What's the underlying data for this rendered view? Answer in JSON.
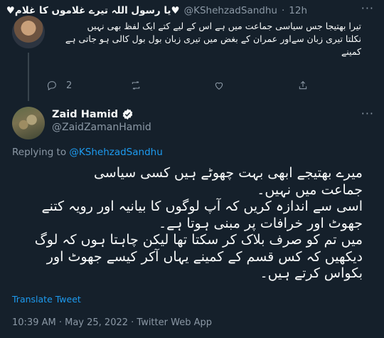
{
  "reply": {
    "display_name": "♥یا رسول اللہ تیرے غلاموں کا غلام♥",
    "handle": "@KShehzadSandhu",
    "separator": "·",
    "time": "12h",
    "text_lines": [
      "تیرا بھتیجا جس سیاسی جماعت میں ہے اس کے لیے کتے ایک لفظ بھی نہیں",
      "نکلتا تیری زبان سےاور عمران کے بغض میں تیری زبان بول بول کالی ہو جاتی ہے",
      "کمینے"
    ],
    "actions": {
      "reply_count": "2",
      "retweet_count": "",
      "like_count": ""
    }
  },
  "tweet": {
    "author_name": "Zaid Hamid",
    "author_handle": "@ZaidZamanHamid",
    "replying_to_label": "Replying to",
    "replying_to_handle": "@KShehzadSandhu",
    "text_lines": [
      "میرے بھتیجے ابھی بہت چھوٹے ہیں کسی سیاسی",
      "جماعت میں نہیں۔",
      "اسی سے اندازہ کریں کہ آپ لوگوں کا بیانیہ اور رویہ کتنے",
      "جھوٹ اور خرافات پر مبنی ہوتا ہے۔",
      "میں تم کو صرف بلاک کر سکتا تھا لیکن چاہتا ہوں کہ لوگ",
      "دیکھیں کہ کس قسم کے کمینے یہاں آکر کیسے جھوٹ اور",
      "بکواس کرتے ہیں۔"
    ],
    "translate_label": "Translate Tweet",
    "timestamp": "10:39 AM · May 25, 2022 · Twitter Web App"
  },
  "colors": {
    "background": "#15202b",
    "accent": "#1d9bf0",
    "muted": "#8b98a5",
    "text": "#f7f9f9"
  }
}
